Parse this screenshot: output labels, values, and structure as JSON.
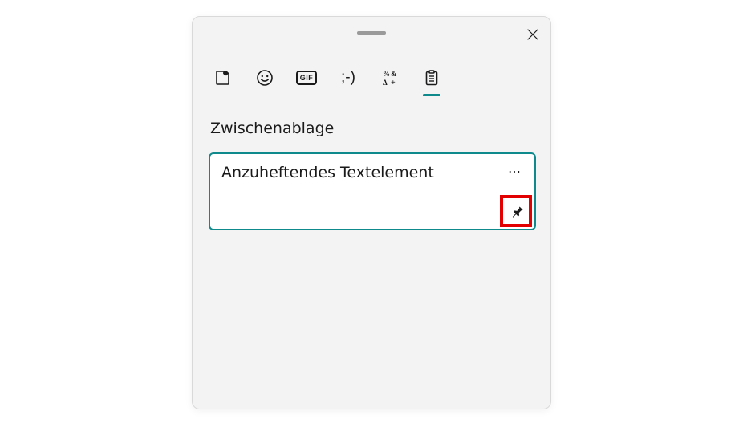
{
  "panel": {
    "section_title": "Zwischenablage",
    "close_label": "Schließen"
  },
  "tabs": {
    "favorites": "Favoriten",
    "emoji": "Emoji",
    "gif": "GIF",
    "kaomoji": ";-)",
    "symbols": "%&\nΔ+",
    "clipboard": "Zwischenablage",
    "active": "clipboard"
  },
  "clipboard_items": [
    {
      "text": "Anzuheftendes Textelement",
      "pinned": false
    }
  ],
  "actions": {
    "more": "⋯",
    "pin": "Anheften"
  },
  "colors": {
    "accent": "#0e8a8c",
    "panel_bg": "#f3f3f3",
    "highlight": "#e30000"
  }
}
